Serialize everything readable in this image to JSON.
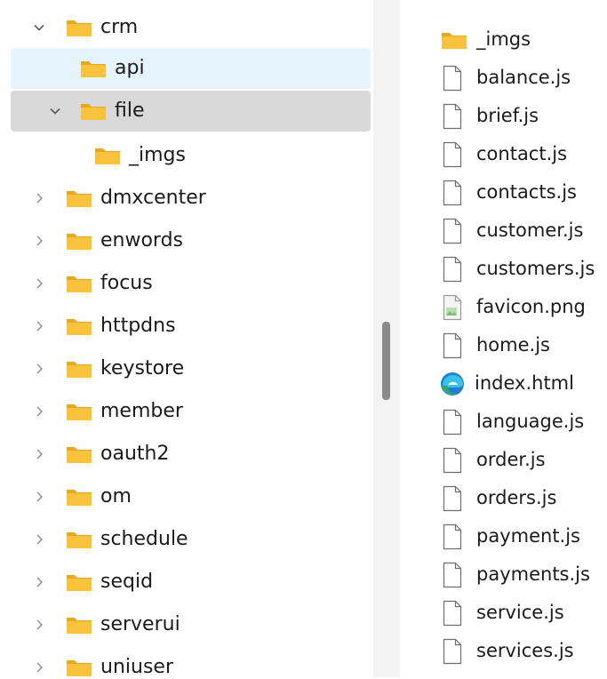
{
  "tree": {
    "items": [
      {
        "label": "crm",
        "expanded": true,
        "level": 0,
        "state": "none"
      },
      {
        "label": "api",
        "expanded": null,
        "level": 1,
        "state": "hover"
      },
      {
        "label": "file",
        "expanded": true,
        "level": 1,
        "state": "selected"
      },
      {
        "label": "_imgs",
        "expanded": null,
        "level": 2,
        "state": "none"
      },
      {
        "label": "dmxcenter",
        "expanded": false,
        "level": 0,
        "state": "none"
      },
      {
        "label": "enwords",
        "expanded": false,
        "level": 0,
        "state": "none"
      },
      {
        "label": "focus",
        "expanded": false,
        "level": 0,
        "state": "none"
      },
      {
        "label": "httpdns",
        "expanded": false,
        "level": 0,
        "state": "none"
      },
      {
        "label": "keystore",
        "expanded": false,
        "level": 0,
        "state": "none"
      },
      {
        "label": "member",
        "expanded": false,
        "level": 0,
        "state": "none"
      },
      {
        "label": "oauth2",
        "expanded": false,
        "level": 0,
        "state": "none"
      },
      {
        "label": "om",
        "expanded": false,
        "level": 0,
        "state": "none"
      },
      {
        "label": "schedule",
        "expanded": false,
        "level": 0,
        "state": "none"
      },
      {
        "label": "seqid",
        "expanded": false,
        "level": 0,
        "state": "none"
      },
      {
        "label": "serverui",
        "expanded": false,
        "level": 0,
        "state": "none"
      },
      {
        "label": "uniuser",
        "expanded": false,
        "level": 0,
        "state": "none"
      }
    ]
  },
  "files": {
    "items": [
      {
        "name": "_imgs",
        "icon": "folder-icon"
      },
      {
        "name": "balance.js",
        "icon": "file-icon"
      },
      {
        "name": "brief.js",
        "icon": "file-icon"
      },
      {
        "name": "contact.js",
        "icon": "file-icon"
      },
      {
        "name": "contacts.js",
        "icon": "file-icon"
      },
      {
        "name": "customer.js",
        "icon": "file-icon"
      },
      {
        "name": "customers.js",
        "icon": "file-icon"
      },
      {
        "name": "favicon.png",
        "icon": "image-file-icon"
      },
      {
        "name": "home.js",
        "icon": "file-icon"
      },
      {
        "name": "index.html",
        "icon": "edge-browser-icon"
      },
      {
        "name": "language.js",
        "icon": "file-icon"
      },
      {
        "name": "order.js",
        "icon": "file-icon"
      },
      {
        "name": "orders.js",
        "icon": "file-icon"
      },
      {
        "name": "payment.js",
        "icon": "file-icon"
      },
      {
        "name": "payments.js",
        "icon": "file-icon"
      },
      {
        "name": "service.js",
        "icon": "file-icon"
      },
      {
        "name": "services.js",
        "icon": "file-icon"
      }
    ]
  },
  "colors": {
    "hover": "#e5f3fb",
    "selected": "#d9d9d9",
    "folder": "#f8c23c",
    "folder_dark": "#e8a81c"
  }
}
